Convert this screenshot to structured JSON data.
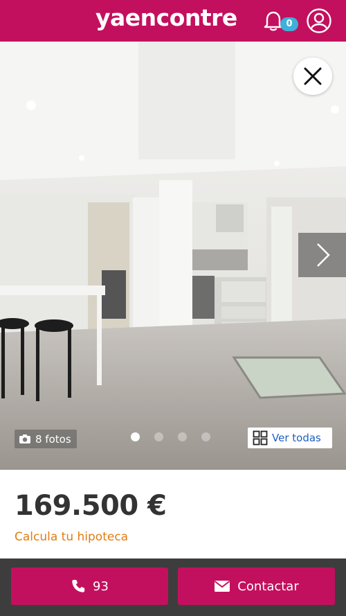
{
  "header": {
    "logo": "yaencontre",
    "notifications_count": "0",
    "icons": {
      "bell": "bell-icon",
      "user": "user-icon"
    },
    "brand_color": "#c3105e"
  },
  "gallery": {
    "photos_label": "8 fotos",
    "view_all_label": "Ver todas",
    "dots_total": 4,
    "active_dot": 0
  },
  "listing": {
    "price": "169.500 €",
    "mortgage_link": "Calcula tu hipoteca"
  },
  "actions": {
    "phone_label": "93",
    "contact_label": "Contactar"
  }
}
